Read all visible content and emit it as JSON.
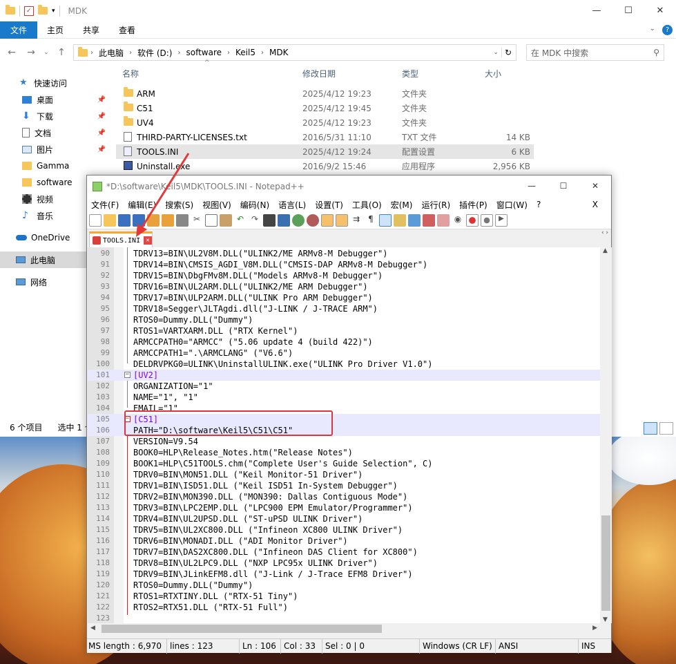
{
  "explorer": {
    "title": "MDK",
    "ribbon_tabs": [
      "文件",
      "主页",
      "共享",
      "查看"
    ],
    "breadcrumb": [
      "此电脑",
      "软件 (D:)",
      "software",
      "Keil5",
      "MDK"
    ],
    "search_placeholder": "在 MDK 中搜索",
    "columns": {
      "name": "名称",
      "date": "修改日期",
      "type": "类型",
      "size": "大小"
    },
    "sidebar": [
      {
        "label": "快速访问",
        "icon": "star-icon"
      },
      {
        "label": "桌面",
        "icon": "desktop-icon"
      },
      {
        "label": "下载",
        "icon": "download-icon"
      },
      {
        "label": "文档",
        "icon": "document-icon"
      },
      {
        "label": "图片",
        "icon": "picture-icon"
      },
      {
        "label": "Gamma",
        "icon": "folder-icon"
      },
      {
        "label": "software",
        "icon": "folder-icon"
      },
      {
        "label": "视频",
        "icon": "video-icon"
      },
      {
        "label": "音乐",
        "icon": "music-icon"
      },
      {
        "label": "OneDrive",
        "icon": "cloud-icon"
      },
      {
        "label": "此电脑",
        "icon": "computer-icon"
      },
      {
        "label": "网络",
        "icon": "network-icon"
      }
    ],
    "files": [
      {
        "name": "ARM",
        "date": "2025/4/12 19:23",
        "type": "文件夹",
        "size": ""
      },
      {
        "name": "C51",
        "date": "2025/4/12 19:45",
        "type": "文件夹",
        "size": ""
      },
      {
        "name": "UV4",
        "date": "2025/4/12 19:23",
        "type": "文件夹",
        "size": ""
      },
      {
        "name": "THIRD-PARTY-LICENSES.txt",
        "date": "2016/5/31 11:10",
        "type": "TXT 文件",
        "size": "14 KB"
      },
      {
        "name": "TOOLS.INI",
        "date": "2025/4/12 19:24",
        "type": "配置设置",
        "size": "6 KB"
      },
      {
        "name": "Uninstall.exe",
        "date": "2016/9/2 15:46",
        "type": "应用程序",
        "size": "2,956 KB"
      }
    ],
    "status": {
      "count": "6 个项目",
      "selected": "选中 1 个"
    }
  },
  "npp": {
    "title": "*D:\\software\\Keil5\\MDK\\TOOLS.INI - Notepad++",
    "menu": [
      "文件(F)",
      "编辑(E)",
      "搜索(S)",
      "视图(V)",
      "编码(N)",
      "语言(L)",
      "设置(T)",
      "工具(O)",
      "宏(M)",
      "运行(R)",
      "插件(P)",
      "窗口(W)",
      "?"
    ],
    "close_x": "X",
    "tab_label": "TOOLS.INI",
    "lines": [
      {
        "n": "90",
        "t": "TDRV13=BIN\\UL2V8M.DLL(\"ULINK2/ME ARMv8-M Debugger\")"
      },
      {
        "n": "91",
        "t": "TDRV14=BIN\\CMSIS_AGDI_V8M.DLL(\"CMSIS-DAP ARMv8-M Debugger\")"
      },
      {
        "n": "92",
        "t": "TDRV15=BIN\\DbgFMv8M.DLL(\"Models ARMv8-M Debugger\")"
      },
      {
        "n": "93",
        "t": "TDRV16=BIN\\UL2ARM.DLL(\"ULINK2/ME ARM Debugger\")"
      },
      {
        "n": "94",
        "t": "TDRV17=BIN\\ULP2ARM.DLL(\"ULINK Pro ARM Debugger\")"
      },
      {
        "n": "95",
        "t": "TDRV18=Segger\\JLTAgdi.dll(\"J-LINK / J-TRACE ARM\")"
      },
      {
        "n": "96",
        "t": "RTOS0=Dummy.DLL(\"Dummy\")"
      },
      {
        "n": "97",
        "t": "RTOS1=VARTXARM.DLL (\"RTX Kernel\")"
      },
      {
        "n": "98",
        "t": "ARMCCPATH0=\"ARMCC\" (\"5.06 update 4 (build 422)\")"
      },
      {
        "n": "99",
        "t": "ARMCCPATH1=\".\\ARMCLANG\" (\"V6.6\")"
      },
      {
        "n": "100",
        "t": "DELDRVPKG0=ULINK\\UninstallULINK.exe(\"ULINK Pro Driver V1.0\")"
      },
      {
        "n": "101",
        "t": "[UV2]"
      },
      {
        "n": "102",
        "t": "ORGANIZATION=\"1\""
      },
      {
        "n": "103",
        "t": "NAME=\"1\", \"1\""
      },
      {
        "n": "104",
        "t": "EMAIL=\"1\""
      },
      {
        "n": "105",
        "t": "[C51]"
      },
      {
        "n": "106",
        "t": "PATH=\"D:\\software\\Keil5\\C51\\C51\""
      },
      {
        "n": "107",
        "t": "VERSION=V9.54"
      },
      {
        "n": "108",
        "t": "BOOK0=HLP\\Release_Notes.htm(\"Release Notes\")"
      },
      {
        "n": "109",
        "t": "BOOK1=HLP\\C51TOOLS.chm(\"Complete User's Guide Selection\", C)"
      },
      {
        "n": "110",
        "t": "TDRV0=BIN\\MON51.DLL (\"Keil Monitor-51 Driver\")"
      },
      {
        "n": "111",
        "t": "TDRV1=BIN\\ISD51.DLL (\"Keil ISD51 In-System Debugger\")"
      },
      {
        "n": "112",
        "t": "TDRV2=BIN\\MON390.DLL (\"MON390: Dallas Contiguous Mode\")"
      },
      {
        "n": "113",
        "t": "TDRV3=BIN\\LPC2EMP.DLL (\"LPC900 EPM Emulator/Programmer\")"
      },
      {
        "n": "114",
        "t": "TDRV4=BIN\\UL2UPSD.DLL (\"ST-uPSD ULINK Driver\")"
      },
      {
        "n": "115",
        "t": "TDRV5=BIN\\UL2XC800.DLL (\"Infineon XC800 ULINK Driver\")"
      },
      {
        "n": "116",
        "t": "TDRV6=BIN\\MONADI.DLL (\"ADI Monitor Driver\")"
      },
      {
        "n": "117",
        "t": "TDRV7=BIN\\DAS2XC800.DLL (\"Infineon DAS Client for XC800\")"
      },
      {
        "n": "118",
        "t": "TDRV8=BIN\\UL2LPC9.DLL (\"NXP LPC95x ULINK Driver\")"
      },
      {
        "n": "119",
        "t": "TDRV9=BIN\\JLinkEFM8.dll (\"J-Link / J-Trace EFM8 Driver\")"
      },
      {
        "n": "120",
        "t": "RTOS0=Dummy.DLL(\"Dummy\")"
      },
      {
        "n": "121",
        "t": "RTOS1=RTXTINY.DLL (\"RTX-51 Tiny\")"
      },
      {
        "n": "122",
        "t": "RTOS2=RTX51.DLL (\"RTX-51 Full\")"
      },
      {
        "n": "123",
        "t": ""
      }
    ],
    "status": {
      "length": "MS length : 6,970",
      "lines": "lines : 123",
      "ln": "Ln : 106",
      "col": "Col : 33",
      "sel": "Sel : 0 | 0",
      "eol": "Windows (CR LF)",
      "enc": "ANSI",
      "ins": "INS"
    }
  },
  "colors": {
    "accent": "#1979ca",
    "highlight": "#d9363e",
    "section": "#8000ff"
  }
}
